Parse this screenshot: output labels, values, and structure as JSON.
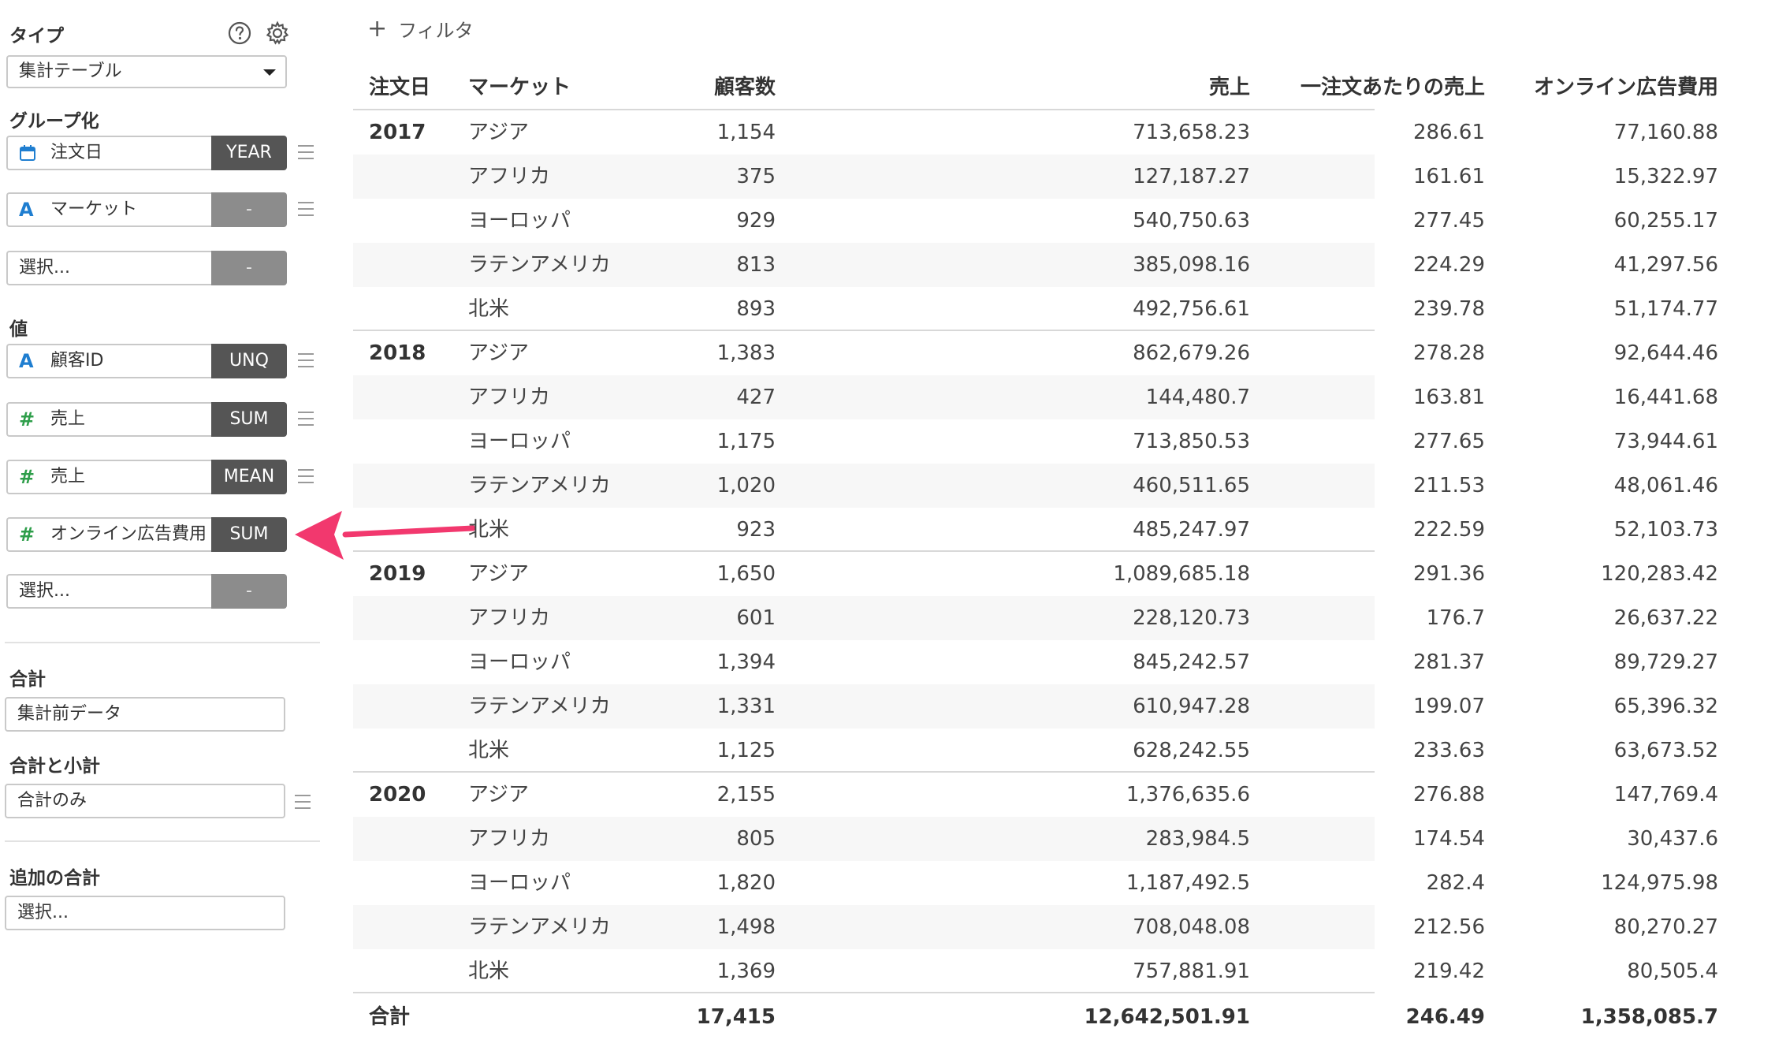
{
  "sidebar": {
    "type_label": "タイプ",
    "type_value": "集計テーブル",
    "group_label": "グループ化",
    "group_fields": [
      {
        "icon": "calendar-icon",
        "name": "注文日",
        "agg": "YEAR"
      },
      {
        "icon": "text-type-icon",
        "name": "マーケット",
        "agg": "-"
      },
      {
        "icon": "",
        "name": "選択...",
        "agg": "-"
      }
    ],
    "value_label": "値",
    "value_fields": [
      {
        "icon": "text-type-icon",
        "name": "顧客ID",
        "agg": "UNQ"
      },
      {
        "icon": "number-type-icon",
        "name": "売上",
        "agg": "SUM"
      },
      {
        "icon": "number-type-icon",
        "name": "売上",
        "agg": "MEAN"
      },
      {
        "icon": "number-type-icon",
        "name": "オンライン広告費用",
        "agg": "SUM"
      },
      {
        "icon": "",
        "name": "選択...",
        "agg": "-"
      }
    ],
    "total_label": "合計",
    "total_value": "集計前データ",
    "subtotal_label": "合計と小計",
    "subtotal_value": "合計のみ",
    "extra_total_label": "追加の合計",
    "extra_total_value": "選択...",
    "icon_a_glyph": "A",
    "icon_num_glyph": "#"
  },
  "filter": {
    "plus": "+",
    "label": "フィルタ"
  },
  "table": {
    "headers": [
      "注文日",
      "マーケット",
      "顧客数",
      "売上",
      "一注文あたりの売上",
      "オンライン広告費用"
    ],
    "groups": [
      {
        "year": "2017",
        "rows": [
          [
            "アジア",
            "1,154",
            "713,658.23",
            "286.61",
            "77,160.88"
          ],
          [
            "アフリカ",
            "375",
            "127,187.27",
            "161.61",
            "15,322.97"
          ],
          [
            "ヨーロッパ",
            "929",
            "540,750.63",
            "277.45",
            "60,255.17"
          ],
          [
            "ラテンアメリカ",
            "813",
            "385,098.16",
            "224.29",
            "41,297.56"
          ],
          [
            "北米",
            "893",
            "492,756.61",
            "239.78",
            "51,174.77"
          ]
        ]
      },
      {
        "year": "2018",
        "rows": [
          [
            "アジア",
            "1,383",
            "862,679.26",
            "278.28",
            "92,644.46"
          ],
          [
            "アフリカ",
            "427",
            "144,480.7",
            "163.81",
            "16,441.68"
          ],
          [
            "ヨーロッパ",
            "1,175",
            "713,850.53",
            "277.65",
            "73,944.61"
          ],
          [
            "ラテンアメリカ",
            "1,020",
            "460,511.65",
            "211.53",
            "48,061.46"
          ],
          [
            "北米",
            "923",
            "485,247.97",
            "222.59",
            "52,103.73"
          ]
        ]
      },
      {
        "year": "2019",
        "rows": [
          [
            "アジア",
            "1,650",
            "1,089,685.18",
            "291.36",
            "120,283.42"
          ],
          [
            "アフリカ",
            "601",
            "228,120.73",
            "176.7",
            "26,637.22"
          ],
          [
            "ヨーロッパ",
            "1,394",
            "845,242.57",
            "281.37",
            "89,729.27"
          ],
          [
            "ラテンアメリカ",
            "1,331",
            "610,947.28",
            "199.07",
            "65,396.32"
          ],
          [
            "北米",
            "1,125",
            "628,242.55",
            "233.63",
            "63,673.52"
          ]
        ]
      },
      {
        "year": "2020",
        "rows": [
          [
            "アジア",
            "2,155",
            "1,376,635.6",
            "276.88",
            "147,769.4"
          ],
          [
            "アフリカ",
            "805",
            "283,984.5",
            "174.54",
            "30,437.6"
          ],
          [
            "ヨーロッパ",
            "1,820",
            "1,187,492.5",
            "282.4",
            "124,975.98"
          ],
          [
            "ラテンアメリカ",
            "1,498",
            "708,048.08",
            "212.56",
            "80,270.27"
          ],
          [
            "北米",
            "1,369",
            "757,881.91",
            "219.42",
            "80,505.4"
          ]
        ]
      }
    ],
    "total": {
      "label": "合計",
      "customers": "17,415",
      "sales": "12,642,501.91",
      "avg": "246.49",
      "ad": "1,358,085.7"
    }
  },
  "colors": {
    "accent_arrow": "#f2386e",
    "agg_button": "#555555",
    "agg_button_empty": "#8c8c8c",
    "text_icon": "#1f7ed0",
    "number_icon": "#2e9e4a"
  }
}
